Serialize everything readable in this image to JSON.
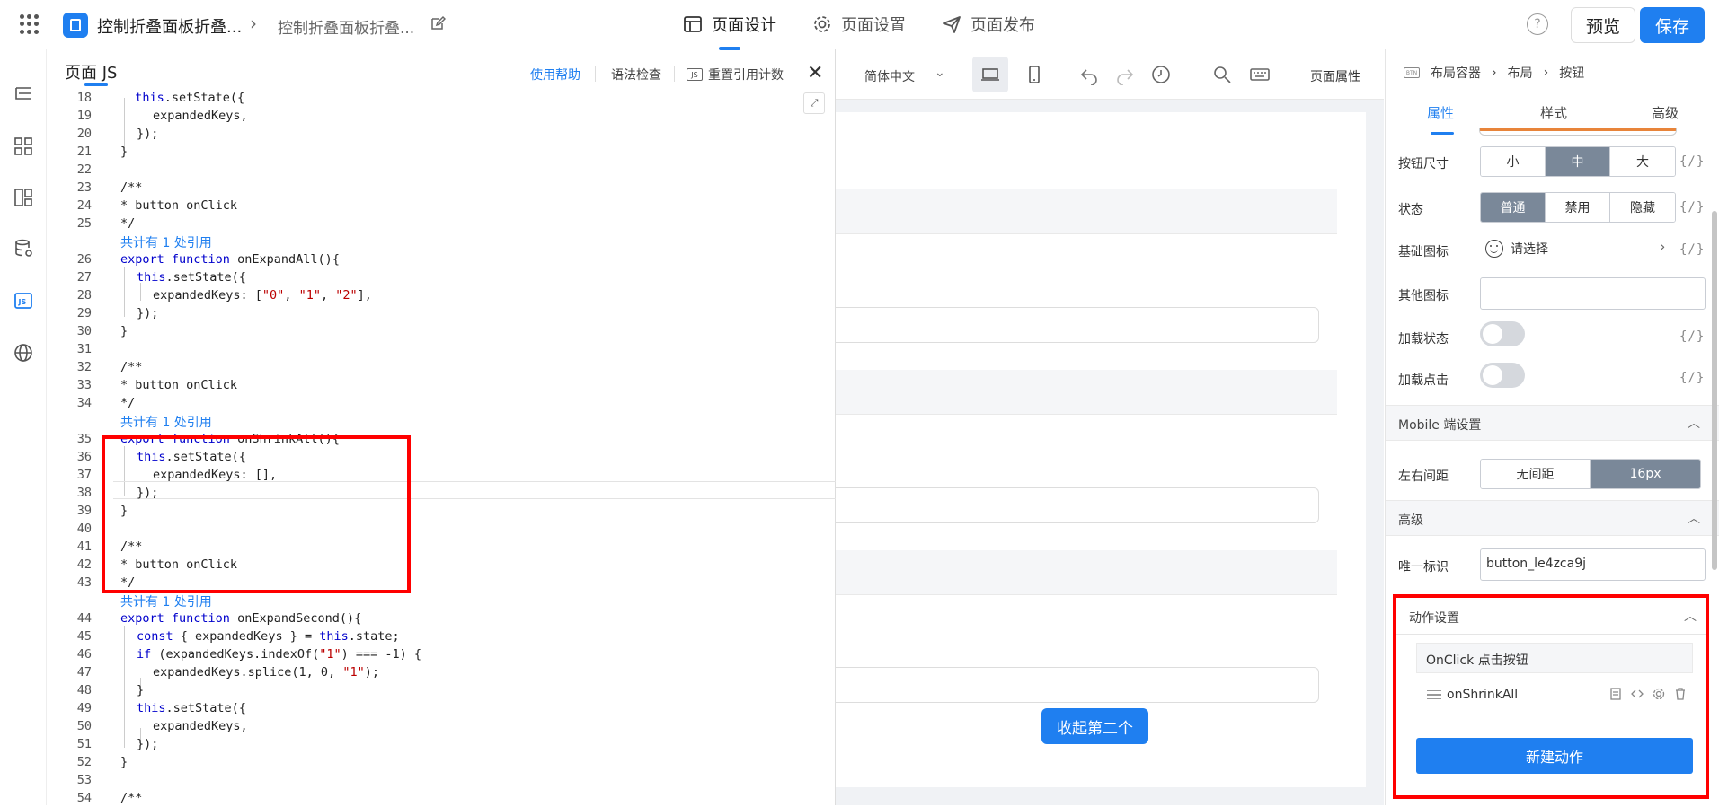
{
  "header": {
    "app_title": "控制折叠面板折叠...",
    "breadcrumb_page": "控制折叠面板折叠...",
    "tabs": [
      {
        "label": "页面设计",
        "active": true
      },
      {
        "label": "页面设置",
        "active": false
      },
      {
        "label": "页面发布",
        "active": false
      }
    ],
    "help_icon": "?",
    "preview_label": "预览",
    "save_label": "保存"
  },
  "editor": {
    "title": "页面 JS",
    "help_label": "使用帮助",
    "lint_label": "语法检查",
    "refcount_label": "重置引用计数",
    "js_badge": "JS",
    "close_glyph": "✕",
    "expand_glyph": "⤢",
    "ref_note": "共计有 1 处引用",
    "lines": {
      "18": "this.setState({",
      "19": "expandedKeys,",
      "20": "});",
      "21": "}",
      "22": "",
      "23": "/**",
      "24": "* button onClick",
      "25": "*/",
      "26a": "export function",
      "26b": "onExpandAll(){",
      "27": "this.setState({",
      "28a": "expandedKeys: [",
      "28s1": "\"0\"",
      "28s2": "\"1\"",
      "28s3": "\"2\"",
      "28e": "],",
      "29": "});",
      "30": "}",
      "31": "",
      "32": "/**",
      "33": "* button onClick",
      "34": "*/",
      "35a": "export function",
      "35b": "onShrinkAll(){",
      "36": "this.setState({",
      "37": "expandedKeys: [],",
      "38": "});",
      "39": "}",
      "40": "",
      "41": "/**",
      "42": "* button onClick",
      "43": "*/",
      "44a": "export function",
      "44b": "onExpandSecond(){",
      "45a": "const",
      "45b": "{ expandedKeys } =",
      "45c": "this",
      "45d": ".state;",
      "46a": "if",
      "46b": "(expandedKeys.indexOf(",
      "46s": "\"1\"",
      "46c": ") === -1) {",
      "47a": "expandedKeys.splice(1, 0,",
      "47s": "\"1\"",
      "47b": ");",
      "48": "}",
      "49": "this.setState({",
      "50": "expandedKeys,",
      "51": "});",
      "52": "}",
      "53": "",
      "54": "/**"
    }
  },
  "canvas": {
    "language": "简体中文",
    "page_props_label": "页面属性",
    "button_label": "收起第二个"
  },
  "props": {
    "breadcrumb": [
      "布局容器",
      "布局",
      "按钮"
    ],
    "tabs": [
      "属性",
      "样式",
      "高级"
    ],
    "var_glyph": "{/}",
    "size": {
      "label": "按钮尺寸",
      "options": [
        "小",
        "中",
        "大"
      ],
      "selected": "中"
    },
    "state": {
      "label": "状态",
      "options": [
        "普通",
        "禁用",
        "隐藏"
      ],
      "selected": "普通"
    },
    "base_icon": {
      "label": "基础图标",
      "placeholder": "请选择"
    },
    "other_icon": {
      "label": "其他图标",
      "value": ""
    },
    "loading": {
      "label": "加载状态",
      "on": false
    },
    "loading_click": {
      "label": "加载点击",
      "on": false
    },
    "mobile_section": "Mobile 端设置",
    "spacing": {
      "label": "左右间距",
      "options": [
        "无间距",
        "16px"
      ],
      "selected": "16px"
    },
    "advanced_section": "高级",
    "unique_id": {
      "label": "唯一标识",
      "value": "button_le4zca9j"
    },
    "action_section": "动作设置",
    "event_label": "OnClick 点击按钮",
    "action_name": "onShrinkAll",
    "new_action_label": "新建动作"
  },
  "colors": {
    "accent": "#1f7ff0",
    "highlight": "#ff0000",
    "segment_selected": "#7a8899"
  }
}
